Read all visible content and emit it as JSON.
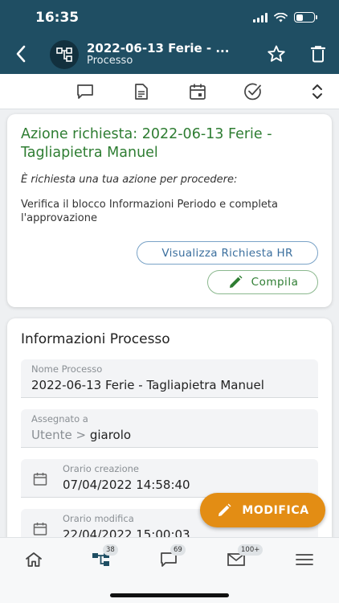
{
  "status_bar": {
    "time": "16:35"
  },
  "header": {
    "title": "2022-06-13 Ferie - ...",
    "subtitle": "Processo"
  },
  "action_card": {
    "title": "Azione richiesta: 2022-06-13 Ferie - Tagliapietra Manuel",
    "prompt": "È richiesta una tua azione per procedere:",
    "description": "Verifica il blocco Informazioni Periodo e completa l'approvazione",
    "hr_button_label": "Visualizza Richiesta HR",
    "compila_button_label": "Compila"
  },
  "info_card": {
    "title": "Informazioni Processo",
    "fields": [
      {
        "label": "Nome Processo",
        "value": "2022-06-13 Ferie - Tagliapietra Manuel"
      },
      {
        "label": "Assegnato a",
        "prefix": "Utente >",
        "value": "giarolo"
      },
      {
        "label": "Orario creazione",
        "value": "07/04/2022 14:58:40"
      },
      {
        "label": "Orario modifica",
        "value": "22/04/2022 15:00:03"
      }
    ]
  },
  "fab": {
    "label": "MODIFICA"
  },
  "bottom_nav": {
    "badges": {
      "processes": "38",
      "messages": "69",
      "mail": "100+"
    }
  },
  "colors": {
    "header_bg": "#1f4e63",
    "accent_green": "#2e7d32",
    "fab_orange": "#e38d14",
    "link_blue": "#3b6f9e"
  }
}
